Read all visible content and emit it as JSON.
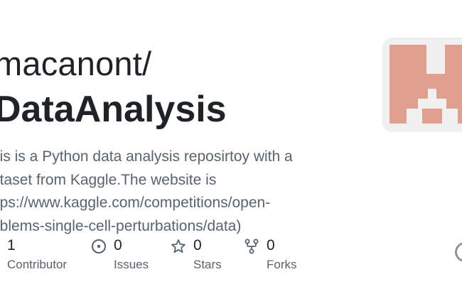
{
  "repo": {
    "owner": "macanont/",
    "name": "DataAnalysis",
    "description_lines": [
      "his is a Python data analysis reposirtoy with a",
      "ataset from Kaggle.The website is",
      "ttps://www.kaggle.com/competitions/open-",
      "oblems-single-cell-perturbations/data)"
    ]
  },
  "stats": [
    {
      "icon": "contributors-icon",
      "count": "1",
      "label": "Contributor"
    },
    {
      "icon": "issues-icon",
      "count": "0",
      "label": "Issues"
    },
    {
      "icon": "star-icon",
      "count": "0",
      "label": "Stars"
    },
    {
      "icon": "fork-icon",
      "count": "0",
      "label": "Forks"
    }
  ],
  "colors": {
    "identicon": "#e0a090",
    "identicon_bg": "#f0f0f0",
    "text_primary": "#1f2328",
    "text_secondary": "#59636e"
  }
}
